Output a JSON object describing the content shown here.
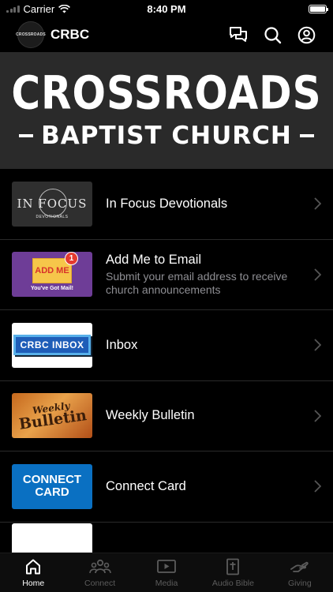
{
  "status_bar": {
    "carrier": "Carrier",
    "time": "8:40 PM"
  },
  "header": {
    "logo_text": "CROSSROADS",
    "title": "CRBC"
  },
  "banner": {
    "line1": "CROSSROADS",
    "line2": "BAPTIST CHURCH"
  },
  "list": {
    "items": [
      {
        "title": "In Focus Devotionals",
        "subtitle": "",
        "thumb_word": "IN FOCUS",
        "thumb_sub": "DEVOTIONALS"
      },
      {
        "title": "Add Me to Email",
        "subtitle": "Submit your email address to receive church announcements",
        "thumb_word": "ADD ME",
        "thumb_badge": "1",
        "thumb_sub": "You've Got Mail!"
      },
      {
        "title": "Inbox",
        "subtitle": "",
        "thumb_word": "CRBC INBOX"
      },
      {
        "title": "Weekly Bulletin",
        "subtitle": "",
        "thumb_word1": "Weekly",
        "thumb_word2": "Bulletin"
      },
      {
        "title": "Connect Card",
        "subtitle": "",
        "thumb_word1": "CONNECT",
        "thumb_word2": "CARD"
      }
    ]
  },
  "tabs": [
    {
      "label": "Home",
      "icon": "home-icon",
      "active": true
    },
    {
      "label": "Connect",
      "icon": "people-icon",
      "active": false
    },
    {
      "label": "Media",
      "icon": "play-icon",
      "active": false
    },
    {
      "label": "Audio Bible",
      "icon": "bible-icon",
      "active": false
    },
    {
      "label": "Giving",
      "icon": "hand-icon",
      "active": false
    }
  ],
  "colors": {
    "background": "#000000",
    "banner": "#2a2a2a",
    "subtitle": "#8e8e93",
    "tab_inactive": "#5c5c5c"
  }
}
